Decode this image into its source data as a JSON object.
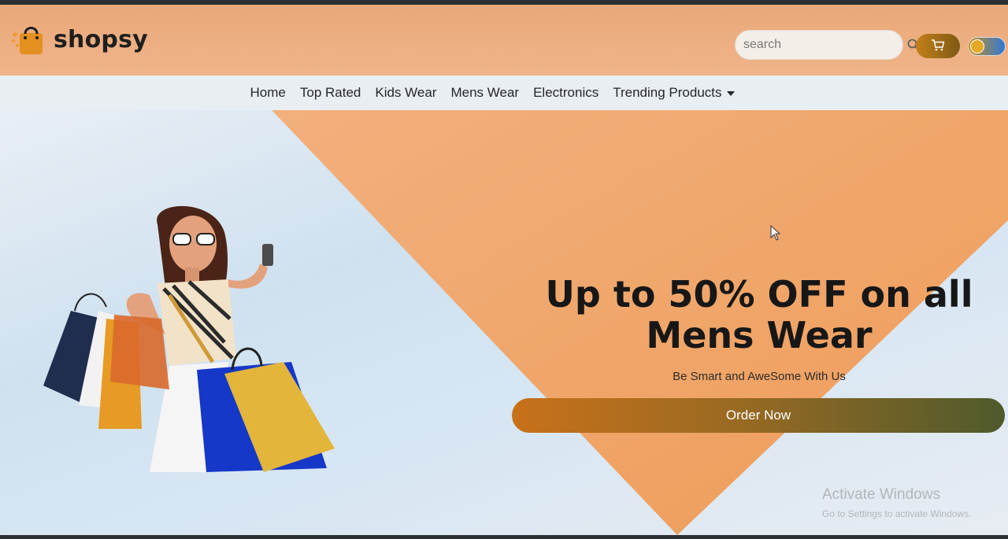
{
  "brand": {
    "name": "shopsy",
    "logo_icon": "shopping-bag-icon",
    "accent_color": "#e48b24"
  },
  "header": {
    "search_placeholder": "search",
    "search_icon": "search-icon",
    "cart_icon": "cart-icon",
    "toggle_icon": "theme-toggle"
  },
  "nav": {
    "items": [
      "Home",
      "Top Rated",
      "Kids Wear",
      "Mens Wear",
      "Electronics"
    ],
    "dropdown_label": "Trending Products"
  },
  "hero": {
    "title": "Up to 50% OFF on all Mens Wear",
    "subtitle": "Be Smart and AweSome With Us",
    "cta_label": "Order Now",
    "image": "woman-with-shopping-bags"
  },
  "watermark": {
    "title": "Activate Windows",
    "subtitle": "Go to Settings to activate Windows."
  },
  "colors": {
    "header_bg": "#eca97c",
    "nav_bg": "#e9eef3",
    "hero_triangle": "#f0a765",
    "cta_start": "#c8711a",
    "cta_end": "#4e5a2c"
  }
}
